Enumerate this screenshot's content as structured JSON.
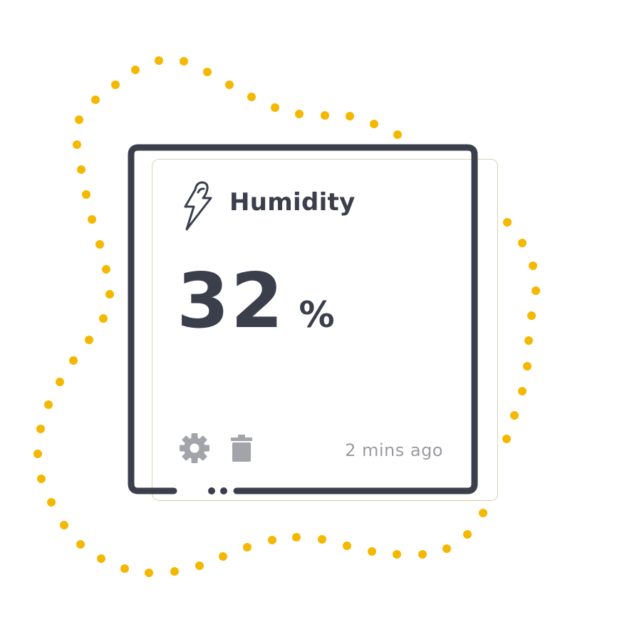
{
  "card": {
    "title": "Humidity",
    "value": "32",
    "unit": "%",
    "timestamp": "2 mins ago",
    "icon": "lightning-bolt-icon"
  },
  "actions": {
    "settings_icon": "gear-icon",
    "delete_icon": "trash-icon"
  },
  "colors": {
    "accent_dots": "#f5b800",
    "text_dark": "#3b3f4c",
    "text_muted": "#9a9ba2",
    "icon_muted": "#a3a4aa"
  }
}
